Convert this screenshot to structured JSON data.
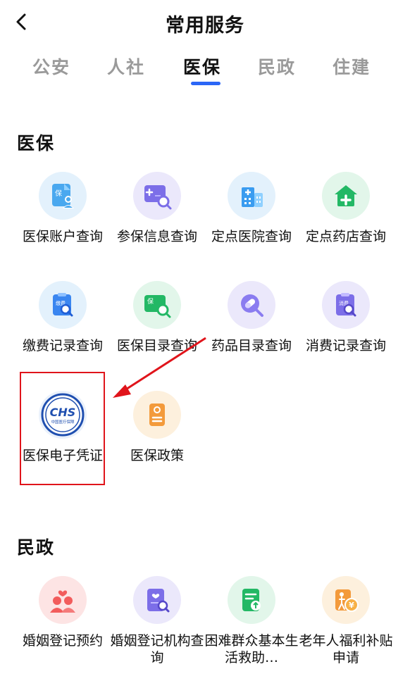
{
  "header": {
    "title": "常用服务"
  },
  "tabs": [
    {
      "label": "公安",
      "active": false
    },
    {
      "label": "人社",
      "active": false
    },
    {
      "label": "医保",
      "active": true
    },
    {
      "label": "民政",
      "active": false
    },
    {
      "label": "住建",
      "active": false
    }
  ],
  "sections": {
    "yibao": {
      "title": "医保",
      "items": [
        {
          "label": "医保账户查询",
          "icon": "insurance-account-icon"
        },
        {
          "label": "参保信息查询",
          "icon": "insurance-info-search-icon"
        },
        {
          "label": "定点医院查询",
          "icon": "hospital-icon"
        },
        {
          "label": "定点药店查询",
          "icon": "pharmacy-icon"
        },
        {
          "label": "缴费记录查询",
          "icon": "payment-record-icon"
        },
        {
          "label": "医保目录查询",
          "icon": "catalog-search-icon"
        },
        {
          "label": "药品目录查询",
          "icon": "medicine-icon"
        },
        {
          "label": "消费记录查询",
          "icon": "consumption-record-icon"
        },
        {
          "label": "医保电子凭证",
          "icon": "chs-logo-icon",
          "logo_text": "CHS",
          "logo_sub": "中国医疗保障"
        },
        {
          "label": "医保政策",
          "icon": "policy-icon"
        }
      ]
    },
    "minzheng": {
      "title": "民政",
      "items": [
        {
          "label": "婚姻登记预约",
          "icon": "couple-icon"
        },
        {
          "label": "婚姻登记机构查询",
          "icon": "marriage-office-search-icon"
        },
        {
          "label": "困难群众基本生活救助…",
          "icon": "assistance-icon"
        },
        {
          "label": "老年人福利补贴申请",
          "icon": "elderly-subsidy-icon"
        }
      ]
    }
  },
  "colors": {
    "accent": "#2b66f6",
    "highlight": "#e0141b"
  }
}
